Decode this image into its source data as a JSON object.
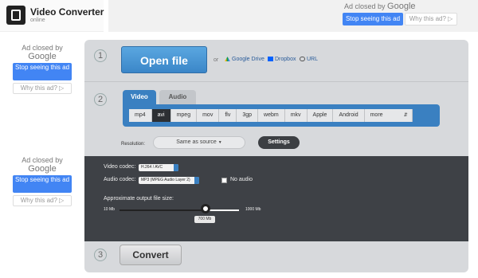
{
  "app": {
    "title": "Video Converter",
    "subtitle": "online"
  },
  "ads": {
    "closed_text": "Ad closed by",
    "google": "Google",
    "stop_label": "Stop seeing this ad",
    "why_label": "Why this ad? ▷"
  },
  "steps": {
    "one": "1",
    "two": "2",
    "three": "3"
  },
  "open": {
    "button": "Open file",
    "or": "or",
    "sources": [
      "Google Drive",
      "Dropbox",
      "URL"
    ]
  },
  "tabs": [
    "Video",
    "Audio"
  ],
  "formats": [
    "mp4",
    "avi",
    "mpeg",
    "mov",
    "flv",
    "3gp",
    "webm",
    "mkv",
    "Apple",
    "Android",
    "more"
  ],
  "selected_format": "avi",
  "resolution": {
    "label": "Resolution:",
    "value": "Same as source",
    "settings": "Settings"
  },
  "settings": {
    "video_codec_label": "Video codec:",
    "video_codec": "H.264 / AVC",
    "audio_codec_label": "Audio codec:",
    "audio_codec": "MP3 (MPEG Audio Layer 2)",
    "no_audio": "No audio",
    "size_label": "Approximate output file size:",
    "min": "10 Mb",
    "max": "1000 Mb",
    "current": "700 Mb",
    "slider_fraction": 0.72
  },
  "convert": "Convert",
  "colors": {
    "accent": "#3a80c1",
    "ad_blue": "#4285f4",
    "dark": "#3e4146"
  }
}
